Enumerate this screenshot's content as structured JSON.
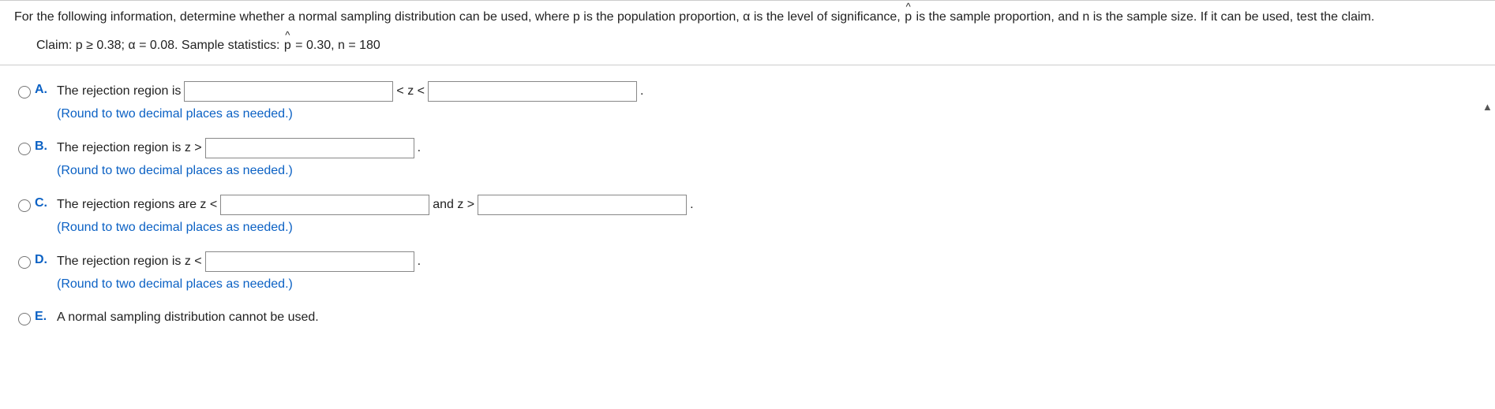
{
  "question": {
    "intro": "For the following information, determine whether a normal sampling distribution can be used, where p is the population proportion, α is the level of significance, ",
    "intro_phat_pre": "",
    "intro_phat_char": "p",
    "intro_after": " is the sample proportion, and n is the sample size. If it can be used, test the claim.",
    "claim_pre": "Claim: p ≥ 0.38; α = 0.08. Sample statistics: ",
    "claim_phat_char": "p",
    "claim_after": " = 0.30, n = 180"
  },
  "options": {
    "A": {
      "label": "A.",
      "text1": "The rejection region is",
      "mid": "< z <",
      "end": ".",
      "note": "(Round to two decimal places as needed.)"
    },
    "B": {
      "label": "B.",
      "text1": "The rejection region is z >",
      "end": ".",
      "note": "(Round to two decimal places as needed.)"
    },
    "C": {
      "label": "C.",
      "text1": "The rejection regions are z <",
      "mid": "and z >",
      "end": ".",
      "note": "(Round to two decimal places as needed.)"
    },
    "D": {
      "label": "D.",
      "text1": "The rejection region is z <",
      "end": ".",
      "note": "(Round to two decimal places as needed.)"
    },
    "E": {
      "label": "E.",
      "text1": "A normal sampling distribution cannot be used."
    }
  }
}
